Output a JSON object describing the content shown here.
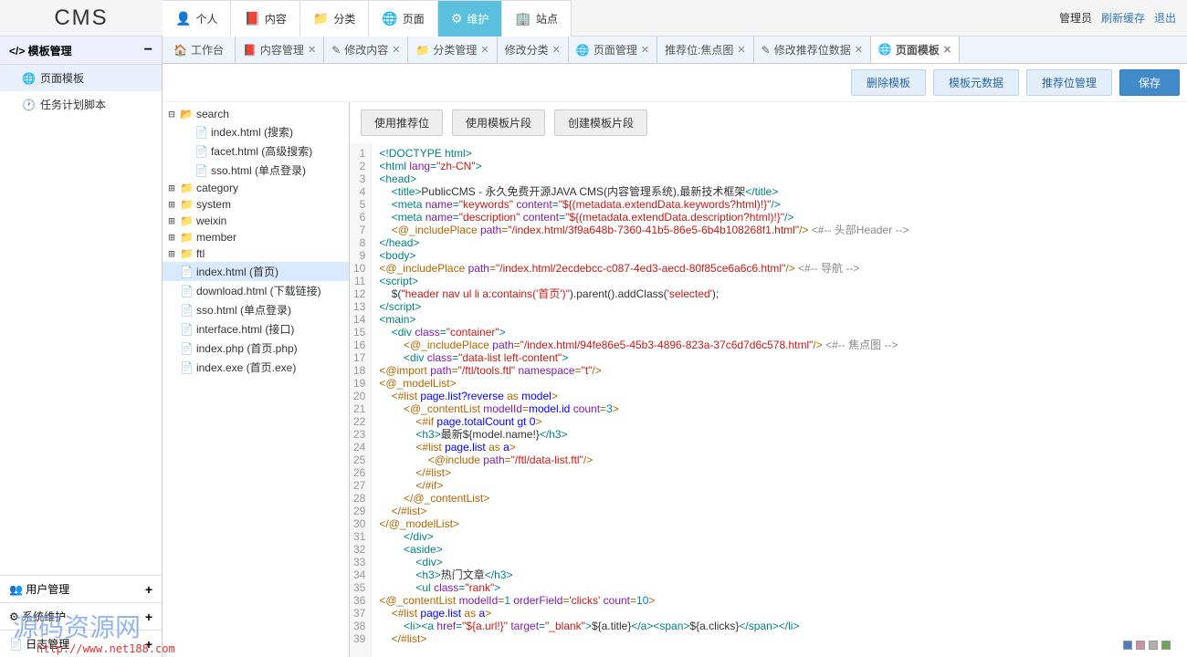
{
  "logo": "CMS",
  "topnav": [
    {
      "icon": "👤",
      "label": "个人"
    },
    {
      "icon": "📕",
      "label": "内容"
    },
    {
      "icon": "📁",
      "label": "分类"
    },
    {
      "icon": "🌐",
      "label": "页面"
    },
    {
      "icon": "⚙",
      "label": "维护",
      "active": true
    },
    {
      "icon": "🏢",
      "label": "站点"
    }
  ],
  "topright": {
    "admin": "管理员",
    "refresh": "刷新缓存",
    "logout": "退出"
  },
  "sidebar": {
    "head": "</> 模板管理",
    "items": [
      {
        "icon": "🌐",
        "label": "页面模板",
        "sel": true
      },
      {
        "icon": "🕐",
        "label": "任务计划脚本"
      }
    ],
    "foot": [
      {
        "icon": "👥",
        "label": "用户管理"
      },
      {
        "icon": "⚙",
        "label": "系统维护"
      },
      {
        "icon": "📄",
        "label": "日志管理"
      }
    ]
  },
  "tabs": [
    {
      "icon": "🏠",
      "label": "工作台",
      "home": true
    },
    {
      "icon": "📕",
      "label": "内容管理",
      "close": true
    },
    {
      "icon": "✎",
      "label": "修改内容",
      "close": true
    },
    {
      "icon": "📁",
      "label": "分类管理",
      "close": true
    },
    {
      "icon": "",
      "label": "修改分类",
      "close": true
    },
    {
      "icon": "🌐",
      "label": "页面管理",
      "close": true
    },
    {
      "icon": "",
      "label": "推荐位:焦点图",
      "close": true
    },
    {
      "icon": "✎",
      "label": "修改推荐位数据",
      "close": true
    },
    {
      "icon": "🌐",
      "label": "页面模板",
      "close": true,
      "active": true
    }
  ],
  "actions": {
    "delete": "删除模板",
    "meta": "模板元数据",
    "rec": "推荐位管理",
    "save": "保存"
  },
  "subbtns": {
    "a": "使用推荐位",
    "b": "使用模板片段",
    "c": "创建模板片段"
  },
  "tree": [
    {
      "d": 0,
      "exp": "⊟",
      "type": "folder-open",
      "label": "search"
    },
    {
      "d": 1,
      "exp": "",
      "type": "file",
      "label": "index.html (搜索)"
    },
    {
      "d": 1,
      "exp": "",
      "type": "file",
      "label": "facet.html (高级搜索)"
    },
    {
      "d": 1,
      "exp": "",
      "type": "file",
      "label": "sso.html (单点登录)"
    },
    {
      "d": 0,
      "exp": "⊞",
      "type": "folder",
      "label": "category"
    },
    {
      "d": 0,
      "exp": "⊞",
      "type": "folder",
      "label": "system"
    },
    {
      "d": 0,
      "exp": "⊞",
      "type": "folder",
      "label": "weixin"
    },
    {
      "d": 0,
      "exp": "⊞",
      "type": "folder",
      "label": "member"
    },
    {
      "d": 0,
      "exp": "⊞",
      "type": "folder",
      "label": "ftl"
    },
    {
      "d": 0,
      "exp": "",
      "type": "file",
      "label": "index.html (首页)",
      "sel": true
    },
    {
      "d": 0,
      "exp": "",
      "type": "file",
      "label": "download.html (下载链接)"
    },
    {
      "d": 0,
      "exp": "",
      "type": "file",
      "label": "sso.html (单点登录)"
    },
    {
      "d": 0,
      "exp": "",
      "type": "file",
      "label": "interface.html (接口)"
    },
    {
      "d": 0,
      "exp": "",
      "type": "file",
      "label": "index.php (首页.php)"
    },
    {
      "d": 0,
      "exp": "",
      "type": "file",
      "label": "index.exe (首页.exe)"
    }
  ],
  "code": [
    [
      {
        "c": "t-tag",
        "t": "<!DOCTYPE html>"
      }
    ],
    [
      {
        "c": "t-tag",
        "t": "<html "
      },
      {
        "c": "t-attr",
        "t": "lang"
      },
      {
        "c": "t-tag",
        "t": "="
      },
      {
        "c": "t-str",
        "t": "\"zh-CN\""
      },
      {
        "c": "t-tag",
        "t": ">"
      }
    ],
    [
      {
        "c": "t-tag",
        "t": "<head>"
      }
    ],
    [
      {
        "c": "t-txt",
        "t": "    "
      },
      {
        "c": "t-tag",
        "t": "<title>"
      },
      {
        "c": "t-txt",
        "t": "PublicCMS - 永久免费开源JAVA CMS(内容管理系统),最新技术框架"
      },
      {
        "c": "t-tag",
        "t": "</title>"
      }
    ],
    [
      {
        "c": "t-txt",
        "t": "    "
      },
      {
        "c": "t-tag",
        "t": "<meta "
      },
      {
        "c": "t-attr",
        "t": "name"
      },
      {
        "c": "t-tag",
        "t": "="
      },
      {
        "c": "t-str",
        "t": "\"keywords\""
      },
      {
        "c": "t-tag",
        "t": " "
      },
      {
        "c": "t-attr",
        "t": "content"
      },
      {
        "c": "t-tag",
        "t": "="
      },
      {
        "c": "t-str",
        "t": "\"${(metadata.extendData.keywords?html)!}\""
      },
      {
        "c": "t-tag",
        "t": "/>"
      }
    ],
    [
      {
        "c": "t-txt",
        "t": "    "
      },
      {
        "c": "t-tag",
        "t": "<meta "
      },
      {
        "c": "t-attr",
        "t": "name"
      },
      {
        "c": "t-tag",
        "t": "="
      },
      {
        "c": "t-str",
        "t": "\"description\""
      },
      {
        "c": "t-tag",
        "t": " "
      },
      {
        "c": "t-attr",
        "t": "content"
      },
      {
        "c": "t-tag",
        "t": "="
      },
      {
        "c": "t-str",
        "t": "\"${(metadata.extendData.description?html)!}\""
      },
      {
        "c": "t-tag",
        "t": "/>"
      }
    ],
    [
      {
        "c": "t-txt",
        "t": "    "
      },
      {
        "c": "t-dir",
        "t": "<@_includePlace "
      },
      {
        "c": "t-attr",
        "t": "path"
      },
      {
        "c": "t-dir",
        "t": "="
      },
      {
        "c": "t-str",
        "t": "\"/index.html/3f9a648b-7360-41b5-86e5-6b4b108268f1.html\""
      },
      {
        "c": "t-dir",
        "t": "/>"
      },
      {
        "c": "t-txt",
        "t": " "
      },
      {
        "c": "t-cmt",
        "t": "<#-- 头部Header -->"
      }
    ],
    [
      {
        "c": "t-tag",
        "t": "</head>"
      }
    ],
    [
      {
        "c": "t-tag",
        "t": "<body>"
      }
    ],
    [
      {
        "c": "t-dir",
        "t": "<@_includePlace "
      },
      {
        "c": "t-attr",
        "t": "path"
      },
      {
        "c": "t-dir",
        "t": "="
      },
      {
        "c": "t-str",
        "t": "\"/index.html/2ecdebcc-c087-4ed3-aecd-80f85ce6a6c6.html\""
      },
      {
        "c": "t-dir",
        "t": "/>"
      },
      {
        "c": "t-txt",
        "t": " "
      },
      {
        "c": "t-cmt",
        "t": "<#-- 导航 -->"
      }
    ],
    [
      {
        "c": "t-tag",
        "t": "<script>"
      }
    ],
    [
      {
        "c": "t-txt",
        "t": "    $("
      },
      {
        "c": "t-str",
        "t": "\"header nav ul li a:contains('首页')\""
      },
      {
        "c": "t-txt",
        "t": ").parent().addClass("
      },
      {
        "c": "t-str",
        "t": "'selected'"
      },
      {
        "c": "t-txt",
        "t": ");"
      }
    ],
    [
      {
        "c": "t-tag",
        "t": "</script>"
      }
    ],
    [
      {
        "c": "t-tag",
        "t": "<main>"
      }
    ],
    [
      {
        "c": "t-txt",
        "t": "    "
      },
      {
        "c": "t-tag",
        "t": "<div "
      },
      {
        "c": "t-attr",
        "t": "class"
      },
      {
        "c": "t-tag",
        "t": "="
      },
      {
        "c": "t-str",
        "t": "\"container\""
      },
      {
        "c": "t-tag",
        "t": ">"
      }
    ],
    [
      {
        "c": "t-txt",
        "t": "        "
      },
      {
        "c": "t-dir",
        "t": "<@_includePlace "
      },
      {
        "c": "t-attr",
        "t": "path"
      },
      {
        "c": "t-dir",
        "t": "="
      },
      {
        "c": "t-str",
        "t": "\"/index.html/94fe86e5-45b3-4896-823a-37c6d7d6c578.html\""
      },
      {
        "c": "t-dir",
        "t": "/>"
      },
      {
        "c": "t-txt",
        "t": " "
      },
      {
        "c": "t-cmt",
        "t": "<#-- 焦点图 -->"
      }
    ],
    [
      {
        "c": "t-txt",
        "t": "        "
      },
      {
        "c": "t-tag",
        "t": "<div "
      },
      {
        "c": "t-attr",
        "t": "class"
      },
      {
        "c": "t-tag",
        "t": "="
      },
      {
        "c": "t-str",
        "t": "\"data-list left-content\""
      },
      {
        "c": "t-tag",
        "t": ">"
      }
    ],
    [
      {
        "c": "t-dir",
        "t": "<@import "
      },
      {
        "c": "t-attr",
        "t": "path"
      },
      {
        "c": "t-dir",
        "t": "="
      },
      {
        "c": "t-str",
        "t": "\"/ftl/tools.ftl\""
      },
      {
        "c": "t-dir",
        "t": " "
      },
      {
        "c": "t-attr",
        "t": "namespace"
      },
      {
        "c": "t-dir",
        "t": "="
      },
      {
        "c": "t-str",
        "t": "\"t\""
      },
      {
        "c": "t-dir",
        "t": "/>"
      }
    ],
    [
      {
        "c": "t-dir",
        "t": "<@_modelList>"
      }
    ],
    [
      {
        "c": "t-txt",
        "t": "    "
      },
      {
        "c": "t-dir",
        "t": "<#list "
      },
      {
        "c": "t-kw",
        "t": "page.list?reverse"
      },
      {
        "c": "t-dir",
        "t": " as "
      },
      {
        "c": "t-kw",
        "t": "model"
      },
      {
        "c": "t-dir",
        "t": ">"
      }
    ],
    [
      {
        "c": "t-txt",
        "t": "        "
      },
      {
        "c": "t-dir",
        "t": "<@_contentList "
      },
      {
        "c": "t-attr",
        "t": "modelId"
      },
      {
        "c": "t-dir",
        "t": "="
      },
      {
        "c": "t-kw",
        "t": "model.id"
      },
      {
        "c": "t-dir",
        "t": " "
      },
      {
        "c": "t-attr",
        "t": "count"
      },
      {
        "c": "t-dir",
        "t": "="
      },
      {
        "c": "t-num",
        "t": "3"
      },
      {
        "c": "t-dir",
        "t": ">"
      }
    ],
    [
      {
        "c": "t-txt",
        "t": "            "
      },
      {
        "c": "t-dir",
        "t": "<#if "
      },
      {
        "c": "t-kw",
        "t": "page.totalCount gt 0"
      },
      {
        "c": "t-dir",
        "t": ">"
      }
    ],
    [
      {
        "c": "t-txt",
        "t": "            "
      },
      {
        "c": "t-tag",
        "t": "<h3>"
      },
      {
        "c": "t-txt",
        "t": "最新${model.name!}"
      },
      {
        "c": "t-tag",
        "t": "</h3>"
      }
    ],
    [
      {
        "c": "t-txt",
        "t": "            "
      },
      {
        "c": "t-dir",
        "t": "<#list "
      },
      {
        "c": "t-kw",
        "t": "page.list"
      },
      {
        "c": "t-dir",
        "t": " as "
      },
      {
        "c": "t-kw",
        "t": "a"
      },
      {
        "c": "t-dir",
        "t": ">"
      }
    ],
    [
      {
        "c": "t-txt",
        "t": "                "
      },
      {
        "c": "t-dir",
        "t": "<@include "
      },
      {
        "c": "t-attr",
        "t": "path"
      },
      {
        "c": "t-dir",
        "t": "="
      },
      {
        "c": "t-str",
        "t": "\"/ftl/data-list.ftl\""
      },
      {
        "c": "t-dir",
        "t": "/>"
      }
    ],
    [
      {
        "c": "t-txt",
        "t": "            "
      },
      {
        "c": "t-dir",
        "t": "</#list>"
      }
    ],
    [
      {
        "c": "t-txt",
        "t": "            "
      },
      {
        "c": "t-dir",
        "t": "</#if>"
      }
    ],
    [
      {
        "c": "t-txt",
        "t": "        "
      },
      {
        "c": "t-dir",
        "t": "</@_contentList>"
      }
    ],
    [
      {
        "c": "t-txt",
        "t": "    "
      },
      {
        "c": "t-dir",
        "t": "</#list>"
      }
    ],
    [
      {
        "c": "t-dir",
        "t": "</@_modelList>"
      }
    ],
    [
      {
        "c": "t-txt",
        "t": "        "
      },
      {
        "c": "t-tag",
        "t": "</div>"
      }
    ],
    [
      {
        "c": "t-txt",
        "t": "        "
      },
      {
        "c": "t-tag",
        "t": "<aside>"
      }
    ],
    [
      {
        "c": "t-txt",
        "t": "            "
      },
      {
        "c": "t-tag",
        "t": "<div>"
      }
    ],
    [
      {
        "c": "t-txt",
        "t": "            "
      },
      {
        "c": "t-tag",
        "t": "<h3>"
      },
      {
        "c": "t-txt",
        "t": "热门文章"
      },
      {
        "c": "t-tag",
        "t": "</h3>"
      }
    ],
    [
      {
        "c": "t-txt",
        "t": "            "
      },
      {
        "c": "t-tag",
        "t": "<ul "
      },
      {
        "c": "t-attr",
        "t": "class"
      },
      {
        "c": "t-tag",
        "t": "="
      },
      {
        "c": "t-str",
        "t": "\"rank\""
      },
      {
        "c": "t-tag",
        "t": ">"
      }
    ],
    [
      {
        "c": "t-dir",
        "t": "<@_contentList "
      },
      {
        "c": "t-attr",
        "t": "modelId"
      },
      {
        "c": "t-dir",
        "t": "="
      },
      {
        "c": "t-num",
        "t": "1"
      },
      {
        "c": "t-dir",
        "t": " "
      },
      {
        "c": "t-attr",
        "t": "orderField"
      },
      {
        "c": "t-dir",
        "t": "="
      },
      {
        "c": "t-str",
        "t": "'clicks'"
      },
      {
        "c": "t-dir",
        "t": " "
      },
      {
        "c": "t-attr",
        "t": "count"
      },
      {
        "c": "t-dir",
        "t": "="
      },
      {
        "c": "t-num",
        "t": "10"
      },
      {
        "c": "t-dir",
        "t": ">"
      }
    ],
    [
      {
        "c": "t-txt",
        "t": "    "
      },
      {
        "c": "t-dir",
        "t": "<#list "
      },
      {
        "c": "t-kw",
        "t": "page.list"
      },
      {
        "c": "t-dir",
        "t": " as "
      },
      {
        "c": "t-kw",
        "t": "a"
      },
      {
        "c": "t-dir",
        "t": ">"
      }
    ],
    [
      {
        "c": "t-txt",
        "t": "        "
      },
      {
        "c": "t-tag",
        "t": "<li><a "
      },
      {
        "c": "t-attr",
        "t": "href"
      },
      {
        "c": "t-tag",
        "t": "="
      },
      {
        "c": "t-str",
        "t": "\"${a.url!}\""
      },
      {
        "c": "t-tag",
        "t": " "
      },
      {
        "c": "t-attr",
        "t": "target"
      },
      {
        "c": "t-tag",
        "t": "="
      },
      {
        "c": "t-str",
        "t": "\"_blank\""
      },
      {
        "c": "t-tag",
        "t": ">"
      },
      {
        "c": "t-txt",
        "t": "${a.title}"
      },
      {
        "c": "t-tag",
        "t": "</a><span>"
      },
      {
        "c": "t-txt",
        "t": "${a.clicks}"
      },
      {
        "c": "t-tag",
        "t": "</span></li>"
      }
    ],
    [
      {
        "c": "t-txt",
        "t": "    "
      },
      {
        "c": "t-dir",
        "t": "</#list>"
      }
    ]
  ],
  "watermark": "源码资源网",
  "watermark_url": "http://www.net188.com",
  "colors": [
    "#4a7ebb",
    "#d18ea6",
    "#b0b0b0",
    "#6aa84f"
  ]
}
